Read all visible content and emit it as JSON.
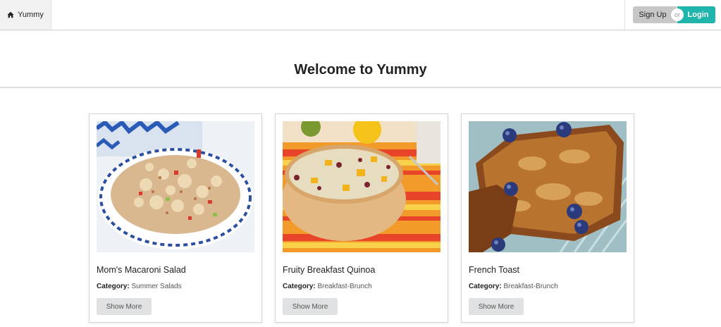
{
  "navbar": {
    "brand_label": "Yummy",
    "brand_icon": "home-icon",
    "signup_label": "Sign Up",
    "or_label": "or",
    "login_label": "Login"
  },
  "header": {
    "title": "Welcome to Yummy"
  },
  "recipes": [
    {
      "title": "Mom's Macaroni Salad",
      "category_label": "Category:",
      "category": "Summer Salads",
      "button_label": "Show More"
    },
    {
      "title": "Fruity Breakfast Quinoa",
      "category_label": "Category:",
      "category": "Breakfast-Brunch",
      "button_label": "Show More"
    },
    {
      "title": "French Toast",
      "category_label": "Category:",
      "category": "Breakfast-Brunch",
      "button_label": "Show More"
    }
  ],
  "colors": {
    "login": "#1fb5ac",
    "signup": "#c7c7c7",
    "show_more": "#e0e1e2"
  }
}
